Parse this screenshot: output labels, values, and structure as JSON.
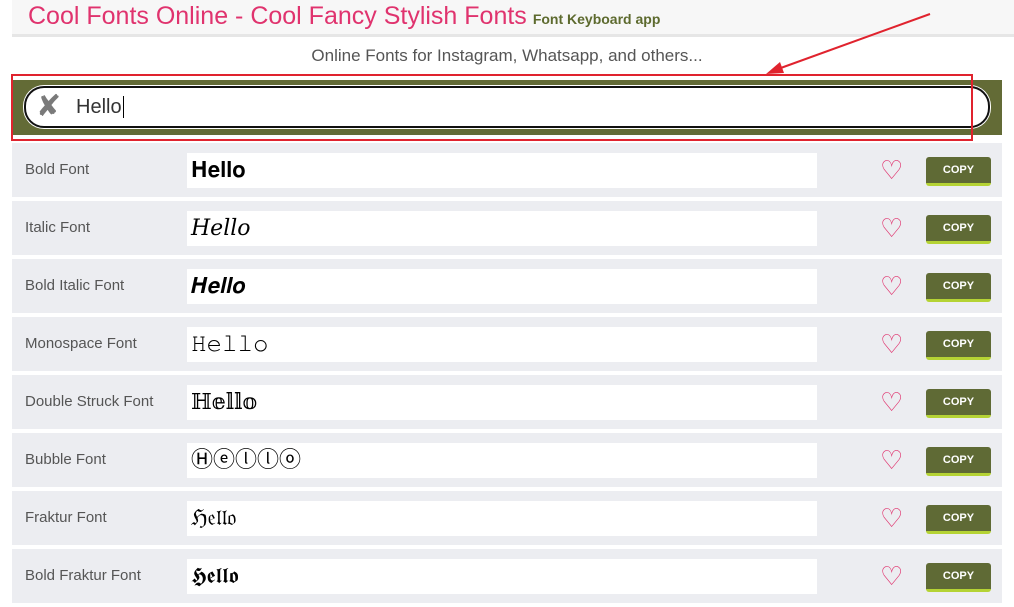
{
  "header": {
    "title": "Cool Fonts Online - Cool Fancy Stylish Fonts",
    "subtitle": "Font Keyboard app"
  },
  "tagline": "Online Fonts for Instagram, Whatsapp, and others...",
  "search": {
    "value": "Hello",
    "clear_icon": "x-icon"
  },
  "copy_label": "COPY",
  "colors": {
    "accent": "#e0336e",
    "bar": "#636b36",
    "highlight": "#e0232e"
  },
  "fonts": [
    {
      "label": "Bold Font",
      "output": "𝐇𝐞𝐥𝐥𝐨"
    },
    {
      "label": "Italic Font",
      "output": "𝐻𝑒𝑙𝑙𝑜"
    },
    {
      "label": "Bold Italic Font",
      "output": "𝑯𝒆𝒍𝒍𝒐"
    },
    {
      "label": "Monospace Font",
      "output": "𝙷𝚎𝚕𝚕𝚘"
    },
    {
      "label": "Double Struck Font",
      "output": "ℍ𝕖𝕝𝕝𝕠"
    },
    {
      "label": "Bubble Font",
      "output": "Ⓗⓔⓛⓛⓞ"
    },
    {
      "label": "Fraktur Font",
      "output": "ℌ𝔢𝔩𝔩𝔬"
    },
    {
      "label": "Bold Fraktur Font",
      "output": "𝕳𝖊𝖑𝖑𝖔"
    }
  ]
}
